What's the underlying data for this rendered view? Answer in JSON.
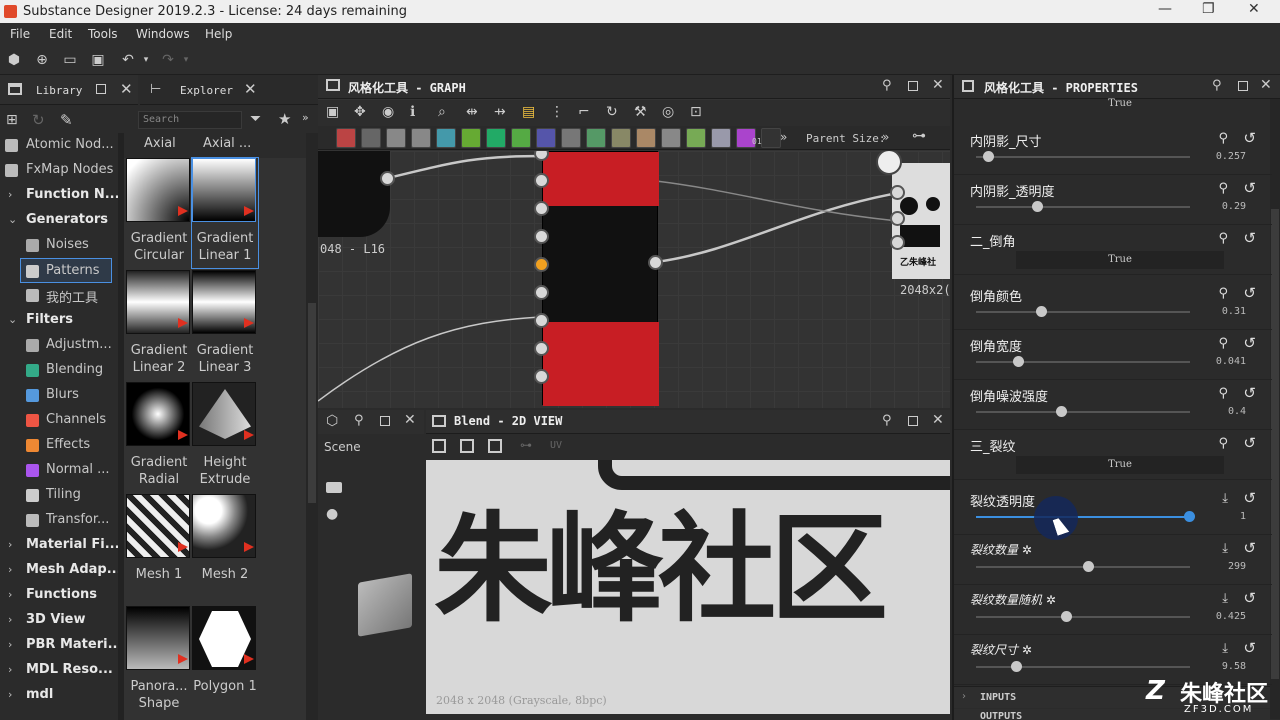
{
  "window": {
    "title": "Substance Designer 2019.2.3 - License: 24 days remaining",
    "minimize": "—",
    "restore": "❐",
    "close": "✕"
  },
  "menu": [
    "File",
    "Edit",
    "Tools",
    "Windows",
    "Help"
  ],
  "library": {
    "tab_library": "Library",
    "tab_explorer": "Explorer",
    "search_placeholder": "Search",
    "tree": [
      {
        "label": "Atomic Nod...",
        "kind": "item"
      },
      {
        "label": "FxMap Nodes",
        "kind": "item"
      },
      {
        "label": "Function N...",
        "kind": "group"
      },
      {
        "label": "Generators",
        "kind": "group-open"
      },
      {
        "label": "Noises",
        "kind": "child"
      },
      {
        "label": "Patterns",
        "kind": "child-selected"
      },
      {
        "label": "我的工具",
        "kind": "child"
      },
      {
        "label": "Filters",
        "kind": "group-open"
      },
      {
        "label": "Adjustm...",
        "kind": "child"
      },
      {
        "label": "Blending",
        "kind": "child"
      },
      {
        "label": "Blurs",
        "kind": "child"
      },
      {
        "label": "Channels",
        "kind": "child"
      },
      {
        "label": "Effects",
        "kind": "child"
      },
      {
        "label": "Normal ...",
        "kind": "child"
      },
      {
        "label": "Tiling",
        "kind": "child"
      },
      {
        "label": "Transfor...",
        "kind": "child"
      },
      {
        "label": "Material Fi...",
        "kind": "group"
      },
      {
        "label": "Mesh Adap...",
        "kind": "group"
      },
      {
        "label": "Functions",
        "kind": "group"
      },
      {
        "label": "3D View",
        "kind": "group"
      },
      {
        "label": "PBR Materi...",
        "kind": "group"
      },
      {
        "label": "MDL Reso...",
        "kind": "group"
      },
      {
        "label": "mdl",
        "kind": "group"
      }
    ],
    "header_labels": [
      "Axial",
      "Axial ..."
    ],
    "thumbnails": [
      {
        "caption": "Gradient\nCircular",
        "l1": "Gradient",
        "l2": "Circular"
      },
      {
        "caption": "Gradient Linear 1",
        "l1": "Gradient",
        "l2": "Linear 1"
      },
      {
        "caption": "Gradient Linear 2",
        "l1": "Gradient",
        "l2": "Linear 2"
      },
      {
        "caption": "Gradient Linear 3",
        "l1": "Gradient",
        "l2": "Linear 3"
      },
      {
        "caption": "Gradient Radial",
        "l1": "Gradient",
        "l2": "Radial"
      },
      {
        "caption": "Height Extrude",
        "l1": "Height",
        "l2": "Extrude"
      },
      {
        "caption": "Mesh 1",
        "l1": "Mesh 1",
        "l2": ""
      },
      {
        "caption": "Mesh 2",
        "l1": "Mesh 2",
        "l2": ""
      },
      {
        "caption": "Panora... Shape",
        "l1": "Panora...",
        "l2": "Shape"
      },
      {
        "caption": "Polygon 1",
        "l1": "Polygon 1",
        "l2": ""
      }
    ]
  },
  "graph": {
    "title": "风格化工具 - GRAPH",
    "parent_size_label": "Parent Size:",
    "node_left_label": "048 - L16",
    "node_right_label": "2048x2(",
    "icon_badge": "01"
  },
  "view2d": {
    "title": "Blend - 2D VIEW",
    "uv_label": "UV",
    "scene_label": "Scene",
    "image_text": "朱峰社区",
    "footer": "2048 x 2048 (Grayscale, 8bpc)"
  },
  "properties": {
    "title": "风格化工具 - PROPERTIES",
    "top_value": "True",
    "rows": [
      {
        "name": "内阴影_尺寸",
        "value": "0.257",
        "fraction": 0.06,
        "type": "slider"
      },
      {
        "name": "内阴影_透明度",
        "value": "0.29",
        "fraction": 0.29,
        "type": "slider"
      },
      {
        "name": "二_倒角",
        "value": "True",
        "type": "bool"
      },
      {
        "name": "倒角颜色",
        "value": "0.31",
        "fraction": 0.31,
        "type": "slider"
      },
      {
        "name": "倒角宽度",
        "value": "0.041",
        "fraction": 0.2,
        "type": "slider"
      },
      {
        "name": "倒角噪波强度",
        "value": "0.4",
        "fraction": 0.4,
        "type": "slider"
      },
      {
        "name": "三_裂纹",
        "value": "True",
        "type": "bool"
      },
      {
        "name": "裂纹透明度",
        "value": "1",
        "fraction": 1.0,
        "type": "slider-active"
      },
      {
        "name": "裂纹数量 ✲",
        "value": "299",
        "fraction": 0.53,
        "type": "slider"
      },
      {
        "name": "裂纹数量随机 ✲",
        "value": "0.425",
        "fraction": 0.425,
        "type": "slider"
      },
      {
        "name": "裂纹尺寸 ✲",
        "value": "9.58",
        "fraction": 0.19,
        "type": "slider"
      }
    ],
    "inputs_label": "INPUTS",
    "outputs_label": "OUTPUTS"
  },
  "watermark": {
    "text": "朱峰社区",
    "sub": "ZF3D.COM"
  },
  "colors": {
    "accent_blue": "#3b8fe0",
    "node_red": "#c81e24",
    "port_orange": "#f0a020"
  }
}
